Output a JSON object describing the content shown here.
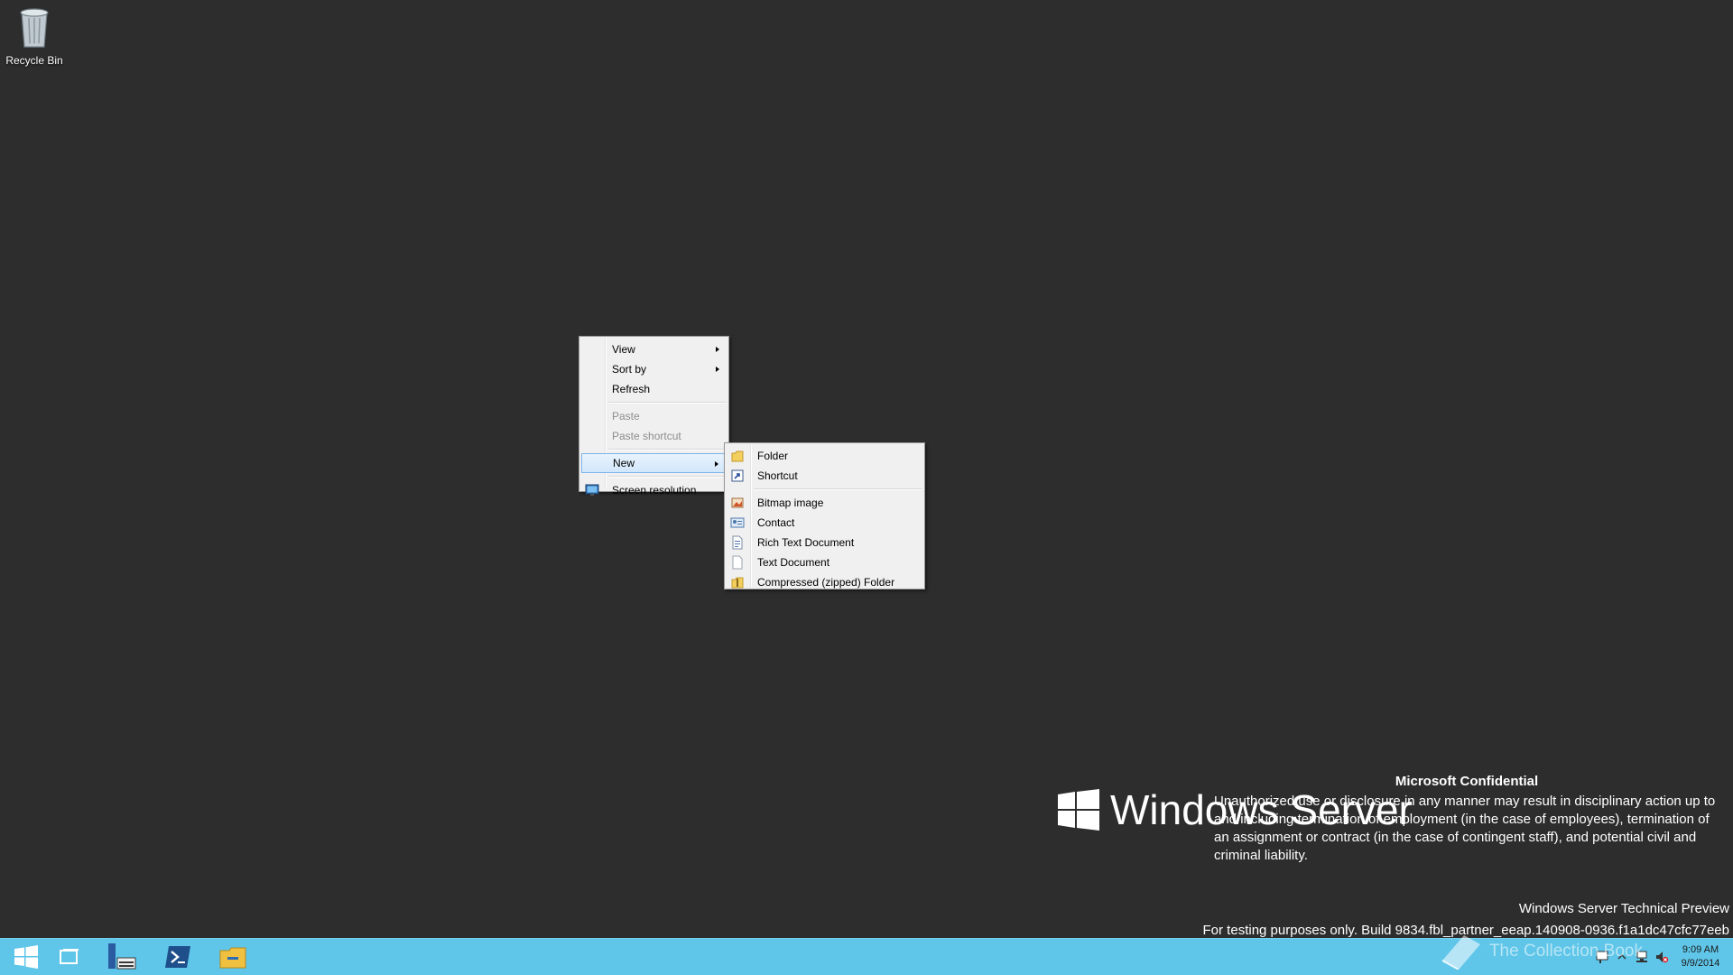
{
  "desktop": {
    "recycle_bin_label": "Recycle Bin"
  },
  "context_menu": {
    "items": [
      {
        "label": "View"
      },
      {
        "label": "Sort by"
      },
      {
        "label": "Refresh"
      },
      {
        "label": "Paste"
      },
      {
        "label": "Paste shortcut"
      },
      {
        "label": "New"
      },
      {
        "label": "Screen resolution"
      }
    ]
  },
  "new_submenu": {
    "items": [
      {
        "label": "Folder",
        "icon": "folder-icon"
      },
      {
        "label": "Shortcut",
        "icon": "shortcut-icon"
      },
      {
        "label": "Bitmap image",
        "icon": "bitmap-icon"
      },
      {
        "label": "Contact",
        "icon": "contact-icon"
      },
      {
        "label": "Rich Text Document",
        "icon": "rich-text-icon"
      },
      {
        "label": "Text Document",
        "icon": "text-document-icon"
      },
      {
        "label": "Compressed (zipped) Folder",
        "icon": "zip-folder-icon"
      }
    ]
  },
  "watermark": {
    "brand": "Windows Server",
    "confidential_title": "Microsoft Confidential",
    "confidential_text": "Unauthorized use or disclosure in any manner may result in disciplinary action up to and including termination of employment (in the case of employees), termination of an assignment or contract (in the case of contingent staff), and potential civil and criminal liability.",
    "edition": "Windows Server Technical Preview",
    "build": "For testing purposes only. Build 9834.fbl_partner_eeap.140908-0936.f1a1dc47cfc77eeb"
  },
  "taskbar": {
    "time": "9:09 AM",
    "date": "9/9/2014",
    "overlay_text": "The Collection Book"
  },
  "colors": {
    "desktop_bg": "#2d2d2d",
    "taskbar_bg": "#5fc6e9",
    "menu_bg": "#f0f0f0",
    "menu_highlight_border": "#7eb4ea"
  }
}
